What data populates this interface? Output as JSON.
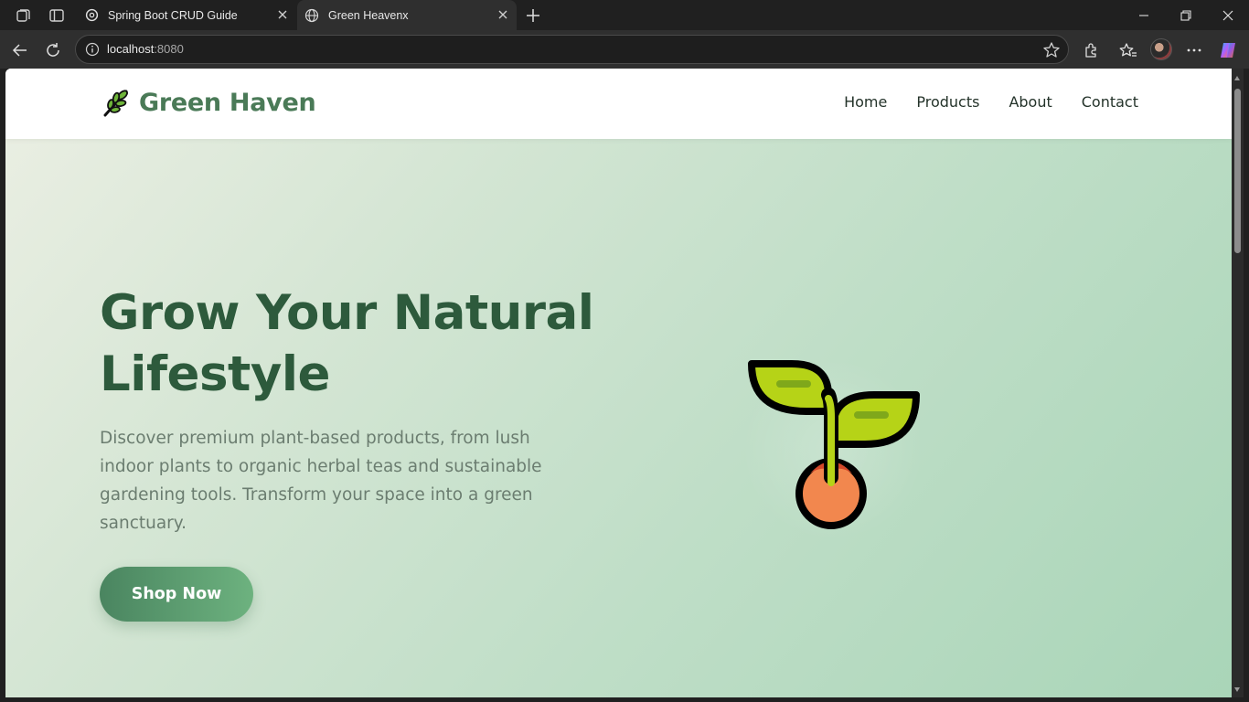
{
  "browser": {
    "tabs": [
      {
        "title": "Spring Boot CRUD Guide",
        "active": false,
        "icon": "openai-icon"
      },
      {
        "title": "Green Heavenx",
        "active": true,
        "icon": "globe-icon"
      }
    ],
    "address": {
      "host": "localhost",
      "port": ":8080"
    }
  },
  "site": {
    "brand": "Green Haven",
    "nav": [
      "Home",
      "Products",
      "About",
      "Contact"
    ]
  },
  "hero": {
    "title": "Grow Your Natural Lifestyle",
    "description": "Discover premium plant-based products, from lush indoor plants to organic herbal teas and sustainable gardening tools. Transform your space into a green sanctuary.",
    "cta": "Shop Now"
  },
  "colors": {
    "brand_green": "#4a7a57",
    "heading_green": "#2d5a3c",
    "cta_start": "#4a8560",
    "cta_end": "#6db27f"
  }
}
